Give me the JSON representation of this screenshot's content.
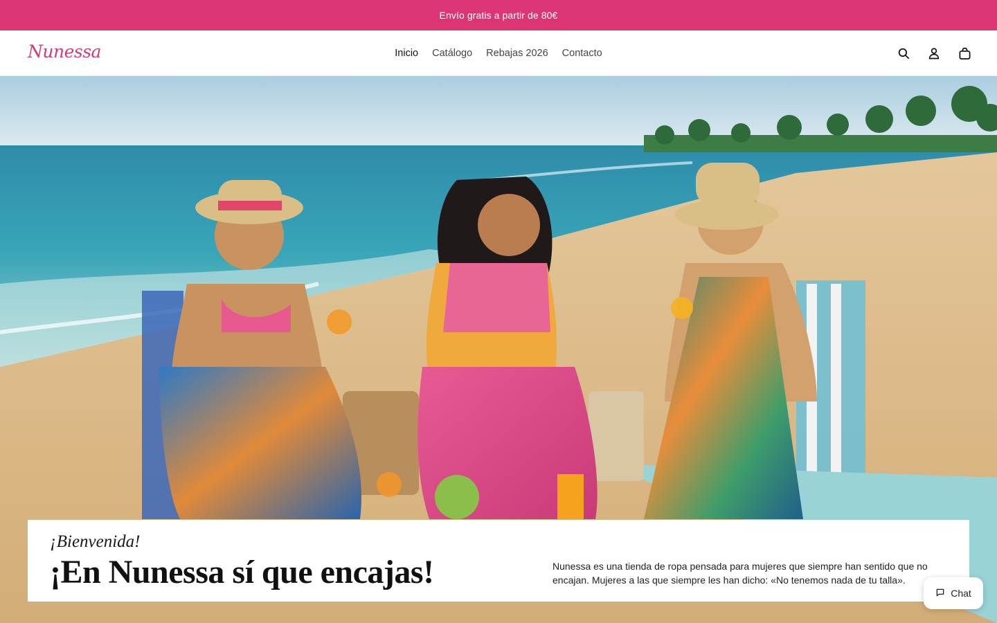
{
  "announcement": {
    "text": "Envío gratis a partir de 80€"
  },
  "header": {
    "logo": "Nunessa",
    "nav": [
      {
        "label": "Inicio",
        "active": true
      },
      {
        "label": "Catálogo"
      },
      {
        "label": "Rebajas 2026"
      },
      {
        "label": "Contacto"
      }
    ],
    "icons": [
      "search-icon",
      "account-icon",
      "cart-icon"
    ]
  },
  "hero": {
    "image": "beach-photo",
    "eyebrow": "¡Bienvenida!",
    "headline": "¡En Nunessa sí que encajas!",
    "description": "Nunessa es una tienda de ropa pensada para mujeres que siempre han sentido que no encajan. Mujeres a las que siempre les han dicho: «No tenemos nada de tu talla»."
  },
  "chat": {
    "label": "Chat",
    "icon": "chat-bubble-icon"
  },
  "colors": {
    "brand": "#dc3474",
    "logo": "#d33a7c"
  }
}
